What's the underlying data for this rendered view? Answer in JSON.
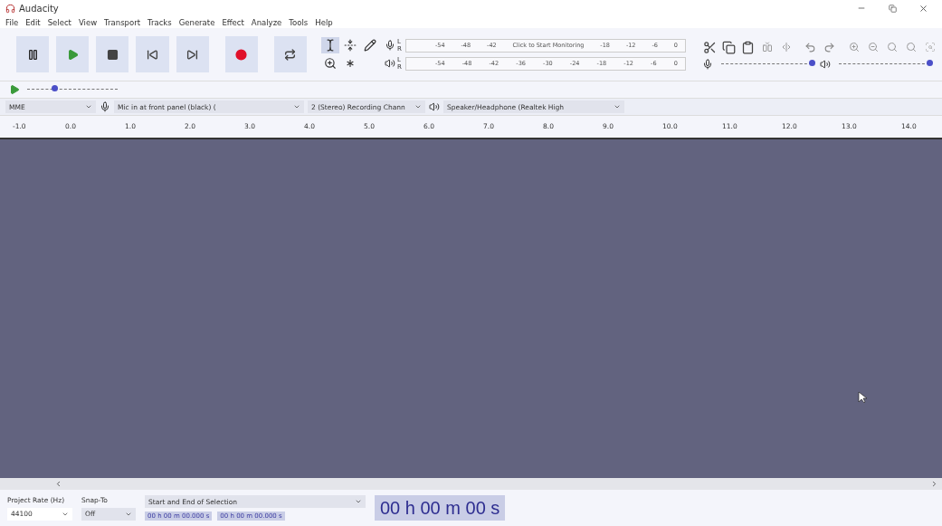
{
  "window": {
    "title": "Audacity"
  },
  "menu": [
    "File",
    "Edit",
    "Select",
    "View",
    "Transport",
    "Tracks",
    "Generate",
    "Effect",
    "Analyze",
    "Tools",
    "Help"
  ],
  "tools": [
    {
      "kind": "selection",
      "selected": true
    },
    {
      "kind": "envelope",
      "selected": false
    },
    {
      "kind": "draw",
      "selected": false
    },
    {
      "kind": "zoom",
      "selected": false
    },
    {
      "kind": "multi",
      "selected": false
    }
  ],
  "meters": [
    {
      "kind": "recording",
      "channels": [
        "L",
        "R"
      ],
      "ticks": [
        "-54",
        "-48",
        "-42",
        "Click to Start Monitoring",
        "-18",
        "-12",
        "-6",
        "0"
      ]
    },
    {
      "kind": "playback",
      "channels": [
        "L",
        "R"
      ],
      "ticks": [
        "-54",
        "-48",
        "-42",
        "-36",
        "-30",
        "-24",
        "-18",
        "-12",
        "-6",
        "0"
      ]
    }
  ],
  "play_at_speed": {
    "level": 0.3
  },
  "mixer": [
    {
      "kind": "recording",
      "level": 1
    },
    {
      "kind": "playback",
      "level": 1
    }
  ],
  "devices": {
    "host": "MME",
    "recording_device": "Mic in at front panel (black) (",
    "channels": "2 (Stereo) Recording Chann",
    "playback_device": "Speaker/Headphone (Realtek High"
  },
  "ruler": [
    "-1.0",
    "0.0",
    "1.0",
    "2.0",
    "3.0",
    "4.0",
    "5.0",
    "6.0",
    "7.0",
    "8.0",
    "9.0",
    "10.0",
    "11.0",
    "12.0",
    "13.0",
    "14.0"
  ],
  "selection_toolbar": {
    "project_rate_label": "Project Rate (Hz)",
    "project_rate": "44100",
    "snap_label": "Snap-To",
    "snap": "Off",
    "mode": "Start and End of Selection",
    "start": "00 h 00 m 00.000 s",
    "end": "00 h 00 m 00.000 s",
    "time": "00 h 00 m 00 s"
  }
}
